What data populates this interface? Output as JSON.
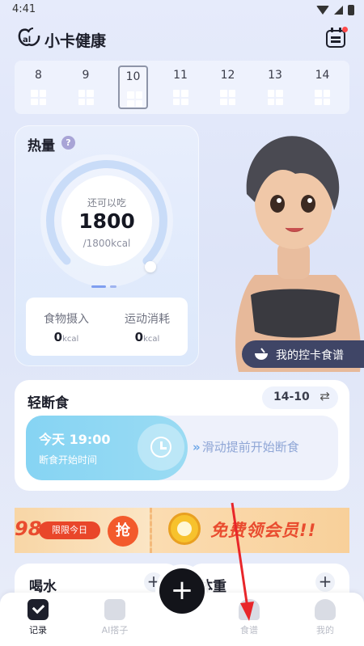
{
  "status_bar": {
    "time": "4:41"
  },
  "app": {
    "title": "小卡健康"
  },
  "dates": [
    "8",
    "9",
    "10",
    "11",
    "12",
    "13",
    "14"
  ],
  "selected_date": "10",
  "calories": {
    "title": "热量",
    "help": "?",
    "remaining_label": "还可以吃",
    "remaining_value": "1800",
    "total": "/1800kcal",
    "progress_fraction": 1.0,
    "food_label": "食物摄入",
    "food_value": "0",
    "food_unit": "kcal",
    "exercise_label": "运动消耗",
    "exercise_value": "0",
    "exercise_unit": "kcal"
  },
  "recipe_button": {
    "label": "我的控卡食谱"
  },
  "fasting": {
    "title": "轻断食",
    "plan": "14-10",
    "plan_icon": "⇄",
    "start_time": "今天 19:00",
    "start_label": "断食开始时间",
    "swipe_hint": "滑动提前开始断食",
    "swipe_arrow": "»"
  },
  "promo": {
    "price": "98",
    "today_only": "限限今日",
    "grab": "抢",
    "cta": "免费领会员!!"
  },
  "water": {
    "title": "喝水",
    "add": "+"
  },
  "weight": {
    "title": "体重",
    "add": "+"
  },
  "fab": {
    "label": "+"
  },
  "tabs": [
    {
      "label": "记录"
    },
    {
      "label": "AI搭子"
    },
    {
      "label": "食谱"
    },
    {
      "label": "我的"
    }
  ],
  "colors": {
    "accent_blue": "#9adbf3",
    "promo_red": "#e94c2f",
    "annotation": "#e8262a"
  }
}
